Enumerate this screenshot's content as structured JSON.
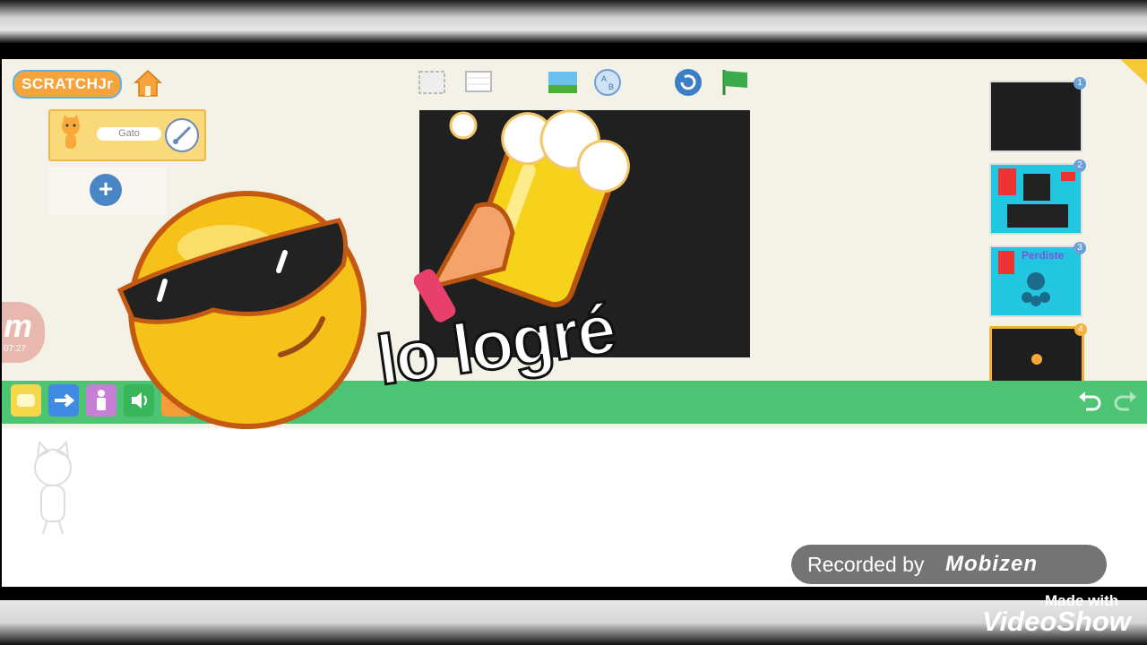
{
  "app": {
    "logo_text": "SCRATCHJr",
    "sprite_name": "Gato",
    "add_label": "+"
  },
  "toolbar": {
    "icons": [
      "fullscreen-icon",
      "grid-icon",
      "background-icon",
      "text-icon",
      "reset-icon",
      "green-flag-icon"
    ]
  },
  "pages": [
    {
      "number": "1",
      "title": ""
    },
    {
      "number": "2",
      "title": ""
    },
    {
      "number": "3",
      "title": "Perdiste"
    },
    {
      "number": "4",
      "title": ""
    }
  ],
  "palette": {
    "categories": [
      "triggering",
      "motion",
      "looks",
      "sound",
      "control"
    ]
  },
  "overlay": {
    "caption": "lo logré"
  },
  "recorder": {
    "mobizen_letter": "m",
    "timer": "07:27",
    "recorded_by": "Recorded by",
    "brand": "Mobizen"
  },
  "watermark": {
    "made_with": "Made with",
    "videoshow": "VideoShow"
  },
  "colors": {
    "palette_bar": "#4cc474",
    "stage": "#202020",
    "app_bg": "#f4f1e6"
  }
}
